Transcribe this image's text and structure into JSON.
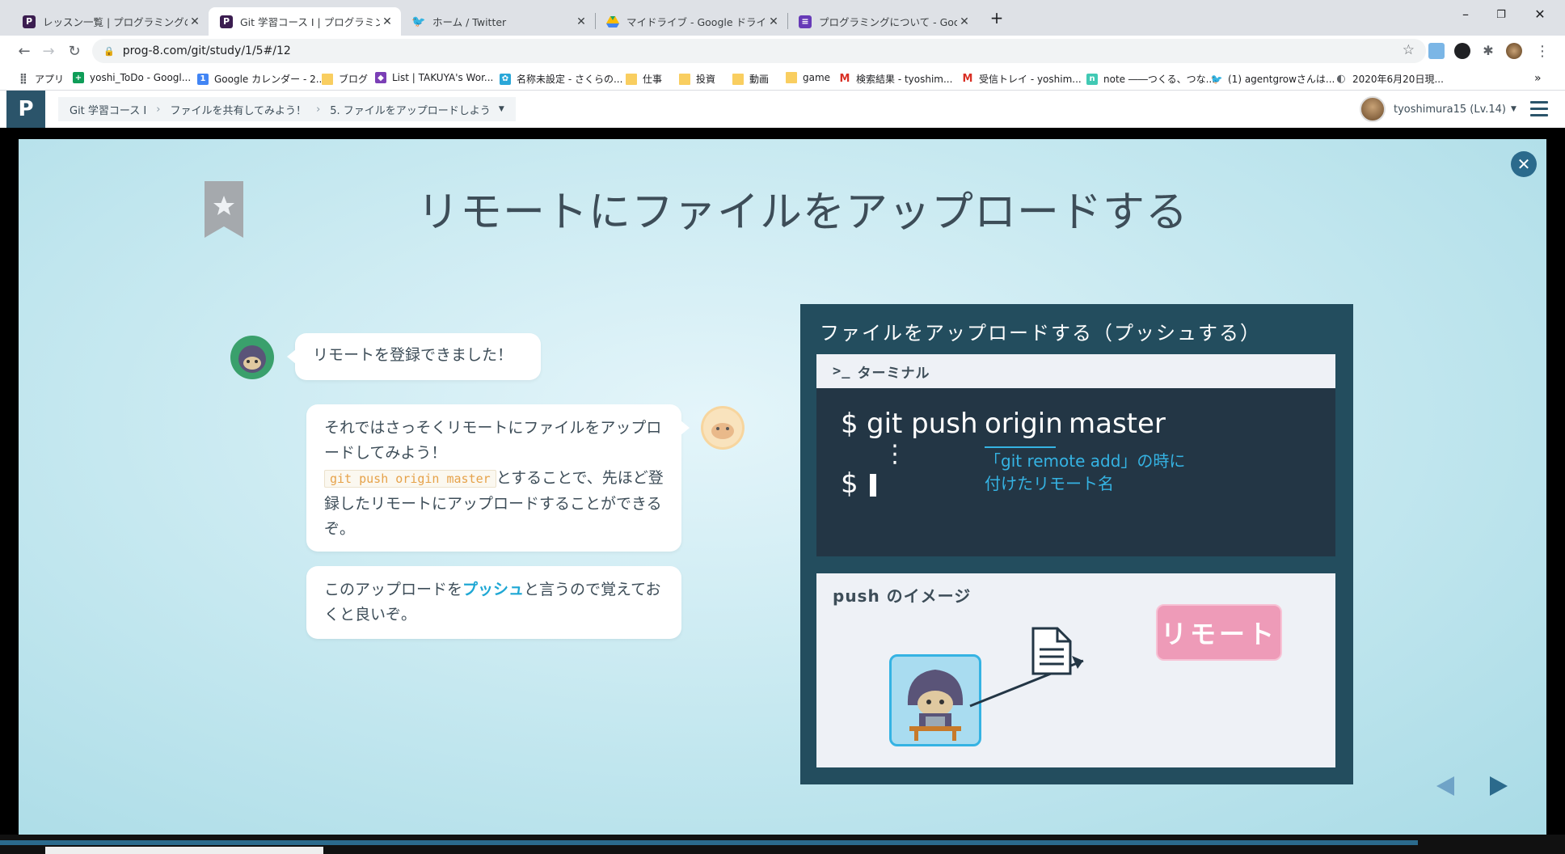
{
  "browser": {
    "tabs": [
      {
        "title": "レッスン一覧 | プログラミングの入門な",
        "icon": "progate-icon",
        "icon_color": "#3b1d50"
      },
      {
        "title": "Git 学習コース I | プログラミングの入門",
        "icon": "progate-icon",
        "icon_color": "#3b1d50"
      },
      {
        "title": "ホーム / Twitter",
        "icon": "twitter-icon",
        "icon_color": "#1da1f2"
      },
      {
        "title": "マイドライブ - Google ドライブ",
        "icon": "drive-icon",
        "icon_color": "#1fa463"
      },
      {
        "title": "プログラミングについて - Google フォー",
        "icon": "forms-icon",
        "icon_color": "#673ab7"
      }
    ],
    "url": "prog-8.com/git/study/1/5#/12",
    "bookmarks": [
      {
        "label": "アプリ",
        "icon": "apps-icon",
        "color": "#5f6368"
      },
      {
        "label": "yoshi_ToDo - Googl...",
        "icon": "sheets-icon",
        "color": "#0f9d58"
      },
      {
        "label": "Google カレンダー - 2...",
        "icon": "calendar-icon",
        "color": "#4285f4"
      },
      {
        "label": "ブログ",
        "icon": "folder-icon",
        "color": "#f9ce60"
      },
      {
        "label": "List | TAKUYA's Wor...",
        "icon": "site-icon",
        "color": "#7b3fb6"
      },
      {
        "label": "名称未設定 - さくらの...",
        "icon": "sakura-icon",
        "color": "#2aa7d8"
      },
      {
        "label": "仕事",
        "icon": "folder-icon",
        "color": "#f9ce60"
      },
      {
        "label": "投資",
        "icon": "folder-icon",
        "color": "#f9ce60"
      },
      {
        "label": "動画",
        "icon": "folder-icon",
        "color": "#f9ce60"
      },
      {
        "label": "game",
        "icon": "folder-icon",
        "color": "#f9ce60"
      },
      {
        "label": "検索結果 - tyoshim...",
        "icon": "gmail-icon",
        "color": "#d93025"
      },
      {
        "label": "受信トレイ - yoshim...",
        "icon": "gmail-icon",
        "color": "#d93025"
      },
      {
        "label": "note ――つくる、つな...",
        "icon": "note-icon",
        "color": "#41c9b4"
      },
      {
        "label": "(1) agentgrowさんは...",
        "icon": "twitter-icon",
        "color": "#1da1f2"
      },
      {
        "label": "2020年6月20日現...",
        "icon": "globe-icon",
        "color": "#5f6368"
      }
    ],
    "more": "»"
  },
  "site": {
    "logo": "P",
    "breadcrumbs": [
      "Git 学習コース I",
      "ファイルを共有してみよう！",
      "5. ファイルをアップロードしよう"
    ],
    "user": "tyoshimura15 (Lv.14)"
  },
  "slide": {
    "title": "リモートにファイルをアップロードする",
    "bubble1": "リモートを登録できました！",
    "bubble2_a": "それではさっそくリモートにファイルをアップロードしてみよう！",
    "bubble2_code": "git push origin master",
    "bubble2_b": "とすることで、先ほど登録したリモートにアップロードすることができるぞ。",
    "bubble3_a": "このアップロードを",
    "bubble3_hl": "プッシュ",
    "bubble3_b": "と言うので覚えておくと良いぞ。",
    "panel_title": "ファイルをアップロードする（プッシュする）",
    "terminal_label": "ターミナル",
    "terminal_prompt_icon": ">_",
    "cmd_dollar": "$",
    "cmd_git_push": "git push",
    "cmd_origin": "origin",
    "cmd_master": "master",
    "note_line1": "「git remote add」の時に",
    "note_line2": "付けたリモート名",
    "dots": "⋮",
    "prompt2": "$",
    "push_label": "push のイメージ",
    "remote_label": "リモート"
  },
  "colors": {
    "accent": "#35b3e3",
    "remote_pink": "#ee9bb8",
    "panel_bg": "#234d5e",
    "terminal_bg": "#233645"
  }
}
